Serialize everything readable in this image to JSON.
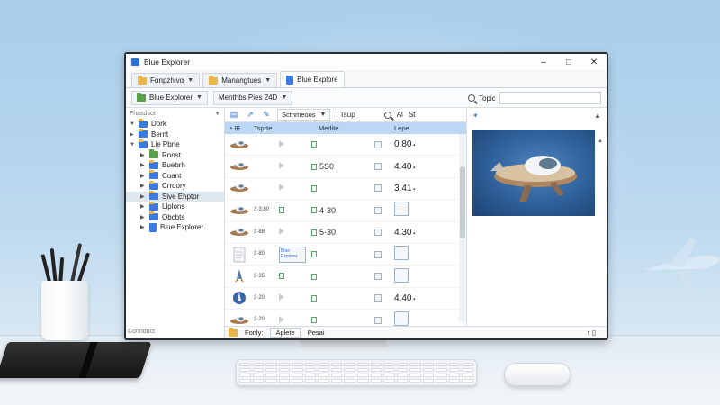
{
  "window": {
    "title": "Blue Explorer",
    "minimize": "–",
    "maximize": "□",
    "close": "✕"
  },
  "tabs": [
    {
      "label": "Fαnpzhlvα",
      "active": false
    },
    {
      "label": "Manangtues",
      "active": false
    },
    {
      "label": "Blue Explore",
      "active": true
    }
  ],
  "address": {
    "crumb1": "Blue Explorer",
    "crumb2": "Menthbs Pies 24D",
    "search_label": "Topic"
  },
  "nav": {
    "header": "Fhasdsot",
    "items": [
      {
        "label": "Dork",
        "level": 0,
        "color": "blue",
        "expanded": true,
        "selected": false
      },
      {
        "label": "Bernt",
        "level": 0,
        "color": "blue",
        "expanded": false,
        "selected": false
      },
      {
        "label": "Lie Pbne",
        "level": 0,
        "color": "blue",
        "expanded": true,
        "selected": false
      },
      {
        "label": "Rnnst",
        "level": 1,
        "color": "green",
        "expanded": false,
        "selected": false
      },
      {
        "label": "Buebrh",
        "level": 1,
        "color": "blue",
        "expanded": false,
        "selected": false
      },
      {
        "label": "Cuant",
        "level": 1,
        "color": "blue",
        "expanded": false,
        "selected": false
      },
      {
        "label": "Crrdory",
        "level": 1,
        "color": "blue",
        "expanded": false,
        "selected": false
      },
      {
        "label": "Sive Ehptor",
        "level": 1,
        "color": "blue",
        "expanded": false,
        "selected": true
      },
      {
        "label": "Llplons",
        "level": 1,
        "color": "blue",
        "expanded": false,
        "selected": false
      },
      {
        "label": "Obcbts",
        "level": 1,
        "color": "blue",
        "expanded": false,
        "selected": false
      },
      {
        "label": "Blue Explorer",
        "level": 1,
        "color": "doc",
        "expanded": false,
        "selected": false
      }
    ],
    "footer": "Conndoct"
  },
  "filepane": {
    "toolbar": {
      "sort_label": "Sctnmeoos",
      "view_label": "Tsup",
      "az_label": "Al",
      "st_label": "St"
    },
    "columns": {
      "name": "Tsprte",
      "modified": "Medite",
      "type": "Lepe"
    },
    "rows": [
      {
        "meta": "",
        "mod": "",
        "val": "0.80"
      },
      {
        "meta": "",
        "mod": "5S0",
        "val": "4.40"
      },
      {
        "meta": "",
        "mod": "",
        "val": "3.41"
      },
      {
        "meta": "3·3:80",
        "mod": "4·30",
        "val": ""
      },
      {
        "meta": "3·88",
        "mod": "5·30",
        "val": "4.30"
      },
      {
        "meta": "3·80",
        "mod": "",
        "val": ""
      },
      {
        "meta": "3·35",
        "mod": "",
        "val": ""
      },
      {
        "meta": "3·20",
        "mod": "",
        "val": "4.40"
      },
      {
        "meta": "3·20",
        "mod": "",
        "val": ""
      },
      {
        "meta": "",
        "mod": "",
        "val": ""
      }
    ],
    "overlay_text": "Blue Explorer"
  },
  "status": {
    "item1": "Fonly:",
    "item2": "Aplete",
    "item3": "Pesai"
  },
  "colors": {
    "header_blue": "#bcd7f3",
    "accent": "#2f6fd6",
    "folder_blue": "#3b7be0",
    "folder_green": "#5aa04a"
  }
}
